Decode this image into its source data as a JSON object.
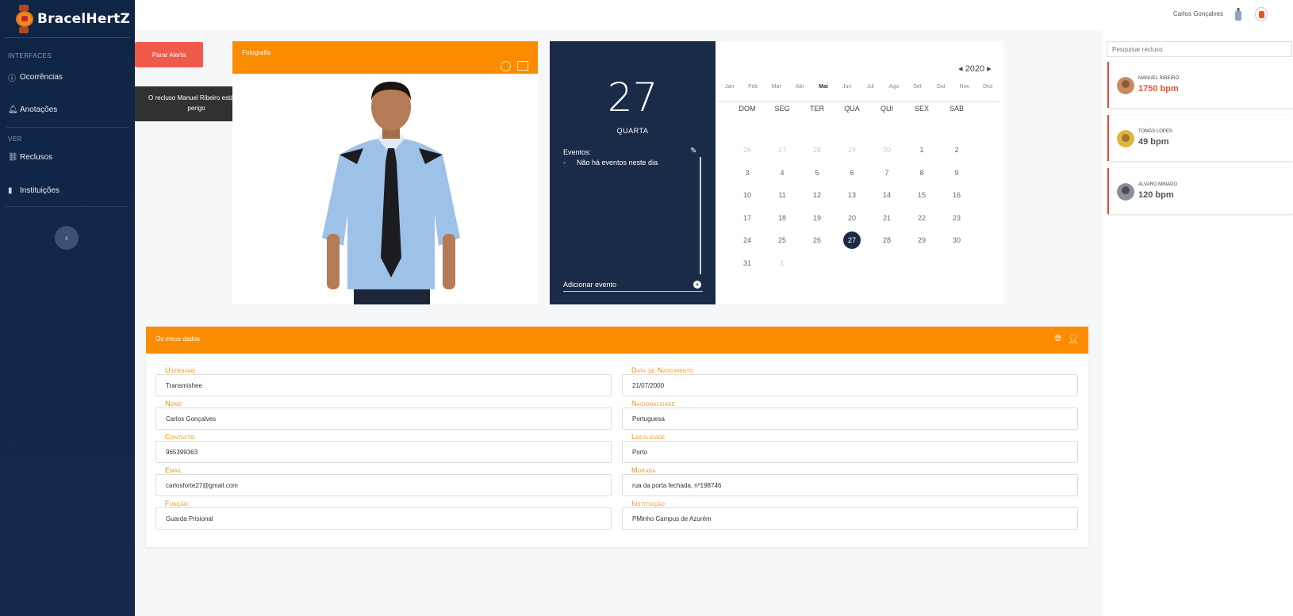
{
  "brand": {
    "title": "BracelHertZ"
  },
  "sidebar": {
    "section_interfaces": "Interfaces",
    "section_ver": "Ver",
    "items": [
      {
        "label": "Ocorrências",
        "icon": "info-circle-icon"
      },
      {
        "label": "Anotações",
        "icon": "bell-icon"
      },
      {
        "label": "Reclusos",
        "icon": "link-icon"
      },
      {
        "label": "Instituições",
        "icon": "bar-chart-icon"
      }
    ],
    "collapse_glyph": "‹"
  },
  "topbar": {
    "user_name": "Carlos Gonçalves"
  },
  "alert": {
    "button_label": "Parar Alerta",
    "tooltip": "O recluso Manuel Ribeiro está em perigo"
  },
  "photo_card": {
    "title": "Fotografia"
  },
  "calendar": {
    "day": "27",
    "weekday": "QUARTA",
    "events_label": "Eventos:",
    "no_events": "Não há eventos neste dia",
    "add_event": "Adicionar evento",
    "year": "2020",
    "months": [
      "Jan",
      "Feb",
      "Mar",
      "Abr",
      "Mai",
      "Jun",
      "Jul",
      "Ago",
      "Set",
      "Out",
      "Nov",
      "Dez"
    ],
    "selected_month": "Mai",
    "weekdays": [
      "DOM",
      "SEG",
      "TER",
      "QUA",
      "QUI",
      "SEX",
      "SÁB"
    ],
    "days": [
      {
        "d": "26",
        "m": true
      },
      {
        "d": "27",
        "m": true
      },
      {
        "d": "28",
        "m": true
      },
      {
        "d": "29",
        "m": true
      },
      {
        "d": "30",
        "m": true
      },
      {
        "d": "1"
      },
      {
        "d": "2"
      },
      {
        "d": "3"
      },
      {
        "d": "4"
      },
      {
        "d": "5"
      },
      {
        "d": "6"
      },
      {
        "d": "7"
      },
      {
        "d": "8"
      },
      {
        "d": "9"
      },
      {
        "d": "10"
      },
      {
        "d": "11"
      },
      {
        "d": "12"
      },
      {
        "d": "13"
      },
      {
        "d": "14"
      },
      {
        "d": "15"
      },
      {
        "d": "16"
      },
      {
        "d": "17"
      },
      {
        "d": "18"
      },
      {
        "d": "19"
      },
      {
        "d": "20"
      },
      {
        "d": "21"
      },
      {
        "d": "22"
      },
      {
        "d": "23"
      },
      {
        "d": "24"
      },
      {
        "d": "25"
      },
      {
        "d": "26"
      },
      {
        "d": "27",
        "today": true
      },
      {
        "d": "28"
      },
      {
        "d": "29"
      },
      {
        "d": "30"
      },
      {
        "d": "31"
      },
      {
        "d": "1",
        "m": true
      }
    ]
  },
  "right_panel": {
    "search_placeholder": "Pesquisar recluso",
    "inmates": [
      {
        "name": "Manuel Ribeiro",
        "bpm": "1750 bpm",
        "alert": true
      },
      {
        "name": "Tomás Lopes",
        "bpm": "49 bpm",
        "alert": false
      },
      {
        "name": "Alvaro Minado",
        "bpm": "120 bpm",
        "alert": false
      }
    ]
  },
  "my_data": {
    "title": "Os meus dados",
    "fields": {
      "username": {
        "label": "Username",
        "value": "Transmishee"
      },
      "nome": {
        "label": "Nome",
        "value": "Carlos Gonçalves"
      },
      "contacto": {
        "label": "Contacto",
        "value": "965399363"
      },
      "email": {
        "label": "Email",
        "value": "carlosforte27@gmail.com"
      },
      "funcao": {
        "label": "Função",
        "value": "Guarda Prisional"
      },
      "nascimento": {
        "label": "Data de Nascimento",
        "value": "21/07/2000"
      },
      "nacionalidade": {
        "label": "Nacionalidade",
        "value": "Portuguesa"
      },
      "localidade": {
        "label": "Localidade",
        "value": "Porto"
      },
      "morada": {
        "label": "Morada",
        "value": "rua da porta fechada, nº198746"
      },
      "instituicao": {
        "label": "Instituição",
        "value": "PMinho Campus de Azurém"
      }
    }
  },
  "colors": {
    "accent": "#fb8c00",
    "sidebar": "#142a4d",
    "alert": "#f05a4a",
    "danger_text": "#e8552f"
  }
}
